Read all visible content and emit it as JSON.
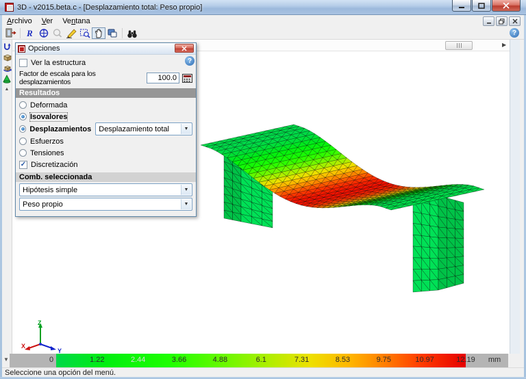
{
  "window": {
    "title": "3D - v2015.beta.c - [Desplazamiento total: Peso propio]"
  },
  "menu": {
    "items": [
      {
        "label": "Archivo",
        "u": 0
      },
      {
        "label": "Ver",
        "u": 0
      },
      {
        "label": "Ventana",
        "u": 2
      }
    ]
  },
  "toolbar": {
    "buttons": [
      "exit",
      "redraw",
      "zoom-all",
      "zoom-previous",
      "edit",
      "zoom-window",
      "pan",
      "copy-view",
      "search"
    ]
  },
  "dialog": {
    "title": "Opciones",
    "checkbox_ver": "Ver la estructura",
    "factor_label": "Factor de escala para los desplazamientos",
    "factor_value": "100.0",
    "section_resultados": "Resultados",
    "options": [
      "Deformada",
      "Isovalores",
      "Desplazamientos",
      "Esfuerzos",
      "Tensiones"
    ],
    "combo_desplazamiento": "Desplazamiento total",
    "check_discretizacion": "Discretización",
    "section_comb": "Comb. seleccionada",
    "combo_hipotesis": "Hipótesis simple",
    "combo_peso": "Peso propio"
  },
  "axes": {
    "x": "X",
    "y": "Y",
    "z": "Z"
  },
  "scalebar": {
    "values": [
      "0",
      "1.22",
      "2.44",
      "3.66",
      "4.88",
      "6.1",
      "7.31",
      "8.53",
      "9.75",
      "10.97",
      "12.19"
    ],
    "max": 12.19,
    "light_value": "2.44",
    "unit": "mm"
  },
  "statusbar": {
    "text": "Seleccione una opción del menú."
  },
  "colors": {
    "axis_x": "#cc1111",
    "axis_y": "#1122cc",
    "axis_z": "#00a020",
    "leg_light": "#00e156",
    "leg_dark": "#00c247",
    "scale_stops": [
      {
        "pos": 0.0,
        "color": "#00d848"
      },
      {
        "pos": 0.12,
        "color": "#00ee10"
      },
      {
        "pos": 0.28,
        "color": "#20ff00"
      },
      {
        "pos": 0.42,
        "color": "#70f700"
      },
      {
        "pos": 0.52,
        "color": "#b0ee00"
      },
      {
        "pos": 0.62,
        "color": "#eee000"
      },
      {
        "pos": 0.72,
        "color": "#ffb400"
      },
      {
        "pos": 0.81,
        "color": "#ff7800"
      },
      {
        "pos": 0.89,
        "color": "#ff3c00"
      },
      {
        "pos": 1.0,
        "color": "#e60000"
      }
    ]
  }
}
